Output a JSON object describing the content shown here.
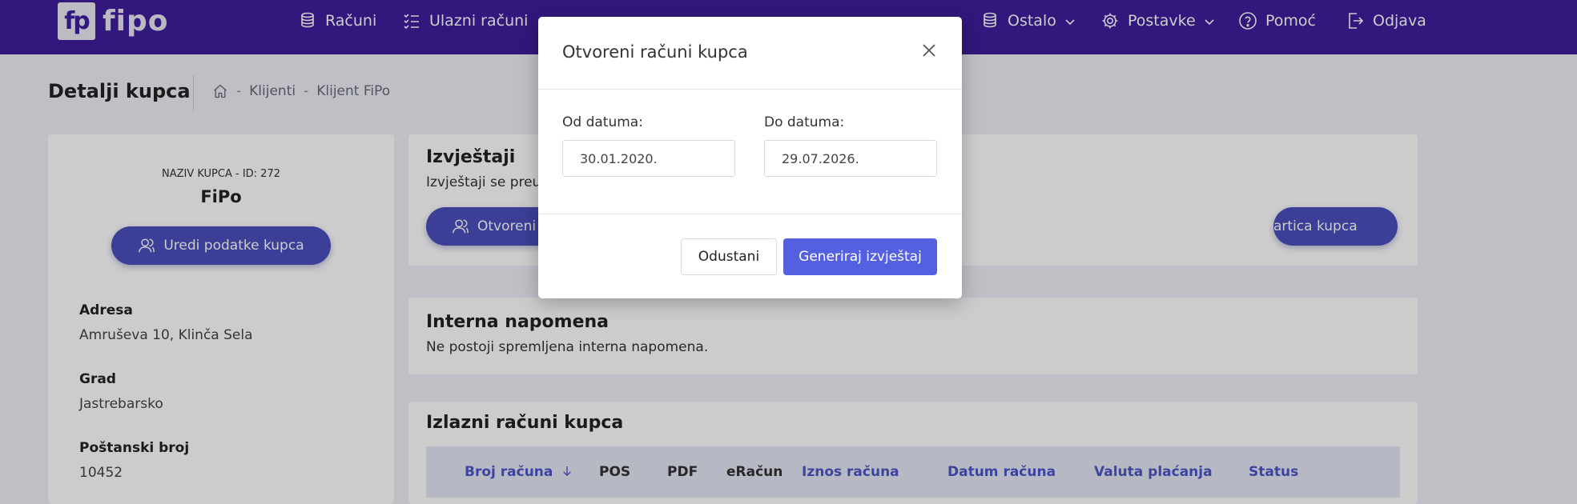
{
  "nav": {
    "logo_mark": "fp",
    "logo_text": "fipo",
    "items": [
      {
        "label": "Računi",
        "icon": "coins-icon"
      },
      {
        "label": "Ulazni računi",
        "icon": "checklist-icon"
      },
      {
        "label": "Ostalo",
        "icon": "coins-icon"
      },
      {
        "label": "Postavke",
        "icon": "gear-icon"
      },
      {
        "label": "Pomoć",
        "icon": "help-circle-icon"
      },
      {
        "label": "Odjava",
        "icon": "logout-icon"
      }
    ]
  },
  "page": {
    "title": "Detalji kupca",
    "breadcrumb": {
      "sep": "-",
      "items": [
        "Klijenti",
        "Klijent FiPo"
      ]
    }
  },
  "customer": {
    "label": "NAZIV KUPCA - ID: 272",
    "name": "FiPo",
    "edit_label": "Uredi podatke kupca",
    "fields": [
      {
        "label": "Adresa",
        "value": "Amruševa 10, Klinča Sela"
      },
      {
        "label": "Grad",
        "value": "Jastrebarsko"
      },
      {
        "label": "Poštanski broj",
        "value": "10452"
      }
    ]
  },
  "reports": {
    "title": "Izvještaji",
    "subtitle": "Izvještaji se preuz",
    "open_invoices_label": "Otvoreni",
    "card_label": "artica kupca"
  },
  "note": {
    "title": "Interna napomena",
    "text": "Ne postoji spremljena interna napomena."
  },
  "invoices": {
    "title": "Izlazni računi kupca",
    "columns": [
      {
        "label": "Broj računa",
        "sortable": true
      },
      {
        "label": "POS",
        "sortable": false
      },
      {
        "label": "PDF",
        "sortable": false
      },
      {
        "label": "eRačun",
        "sortable": false
      },
      {
        "label": "Iznos računa",
        "sortable": true
      },
      {
        "label": "Datum računa",
        "sortable": true
      },
      {
        "label": "Valuta plaćanja",
        "sortable": true
      },
      {
        "label": "Status",
        "sortable": true
      }
    ]
  },
  "modal": {
    "title": "Otvoreni računi kupca",
    "from_label": "Od datuma:",
    "from_value": "30.01.2020.",
    "to_label": "Do datuma:",
    "to_value": "29.07.2026.",
    "cancel_label": "Odustani",
    "generate_label": "Generiraj izvještaj"
  },
  "colors": {
    "nav_bg": "#3f1d9c",
    "primary_button": "#4a4fbd",
    "modal_primary": "#5560e0",
    "link": "#4d56c8"
  }
}
